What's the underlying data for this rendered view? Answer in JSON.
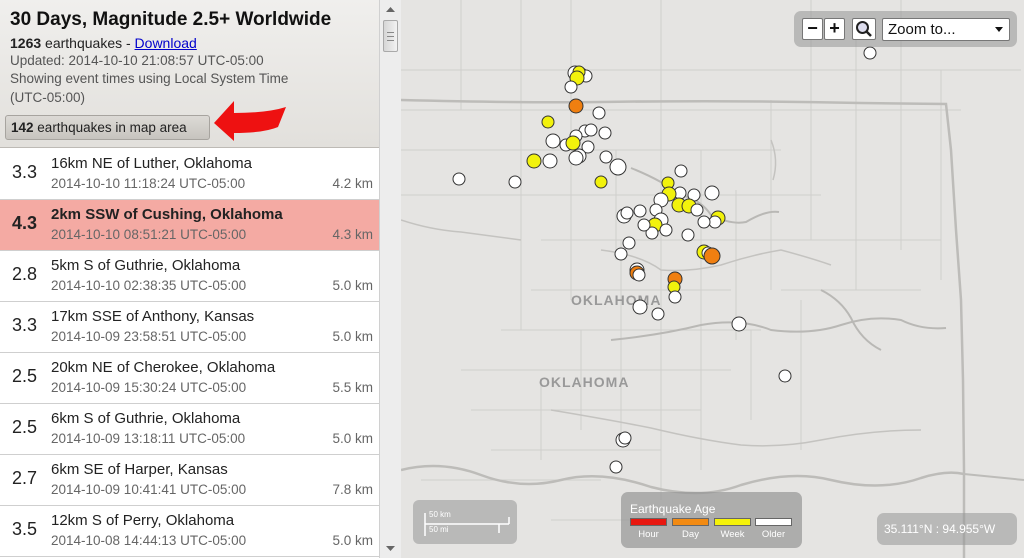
{
  "sidebar": {
    "title": "30 Days, Magnitude 2.5+ Worldwide",
    "count": "1263",
    "count_suffix": "earthquakes - ",
    "download_label": "Download",
    "updated": "Updated: 2014-10-10 21:08:57 UTC-05:00",
    "timezone_info": "Showing event times using Local System Time",
    "timezone": "(UTC-05:00)",
    "map_area_count": "142",
    "map_area_suffix": "earthquakes in map area"
  },
  "earthquakes": [
    {
      "mag": "3.3",
      "place": "16km NE of Luther, Oklahoma",
      "time": "2014-10-10 11:18:24 UTC-05:00",
      "depth": "4.2 km",
      "selected": false
    },
    {
      "mag": "4.3",
      "place": "2km SSW of Cushing, Oklahoma",
      "time": "2014-10-10 08:51:21 UTC-05:00",
      "depth": "4.3 km",
      "selected": true
    },
    {
      "mag": "2.8",
      "place": "5km S of Guthrie, Oklahoma",
      "time": "2014-10-10 02:38:35 UTC-05:00",
      "depth": "5.0 km",
      "selected": false
    },
    {
      "mag": "3.3",
      "place": "17km SSE of Anthony, Kansas",
      "time": "2014-10-09 23:58:51 UTC-05:00",
      "depth": "5.0 km",
      "selected": false
    },
    {
      "mag": "2.5",
      "place": "20km NE of Cherokee, Oklahoma",
      "time": "2014-10-09 15:30:24 UTC-05:00",
      "depth": "5.5 km",
      "selected": false
    },
    {
      "mag": "2.5",
      "place": "6km S of Guthrie, Oklahoma",
      "time": "2014-10-09 13:18:11 UTC-05:00",
      "depth": "5.0 km",
      "selected": false
    },
    {
      "mag": "2.7",
      "place": "6km SE of Harper, Kansas",
      "time": "2014-10-09 10:41:41 UTC-05:00",
      "depth": "7.8 km",
      "selected": false
    },
    {
      "mag": "3.5",
      "place": "12km S of Perry, Oklahoma",
      "time": "2014-10-08 14:44:13 UTC-05:00",
      "depth": "5.0 km",
      "selected": false
    }
  ],
  "map": {
    "zoom_out_label": "−",
    "zoom_in_label": "+",
    "search_icon": "magnifier-icon",
    "zoom_select": "Zoom to...",
    "state_label_1": "OKLAHOMA",
    "state_label_2": "OKLAHOMA",
    "scale_km": "50 km",
    "scale_mi": "50 mi",
    "coords": "35.111°N : 94.955°W",
    "legend": {
      "title": "Earthquake Age",
      "items": [
        {
          "label": "Hour",
          "color": "#e8170f"
        },
        {
          "label": "Day",
          "color": "#f28a12"
        },
        {
          "label": "Week",
          "color": "#f5f20a"
        },
        {
          "label": "Older",
          "color": "#ffffff"
        }
      ]
    },
    "age_colors": {
      "older": "#ffffff",
      "week": "#f2f20c",
      "day": "#f07f10"
    }
  }
}
